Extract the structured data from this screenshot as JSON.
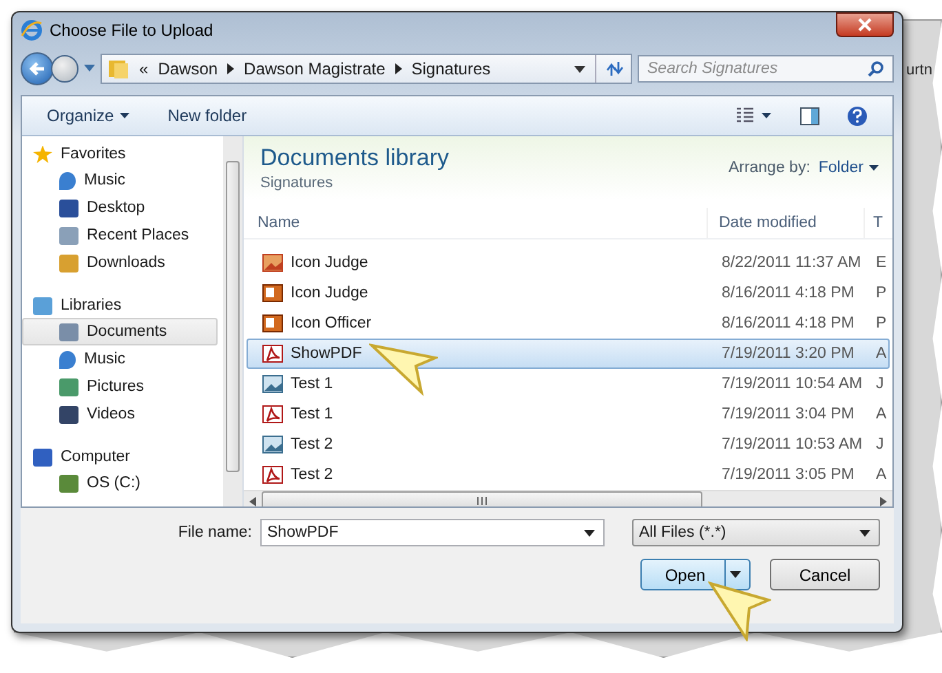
{
  "window": {
    "title": "Choose File to Upload"
  },
  "address_bar": {
    "crumbs": [
      "«",
      "Dawson",
      "Dawson Magistrate",
      "Signatures"
    ]
  },
  "search": {
    "placeholder": "Search Signatures"
  },
  "toolbar": {
    "organize": "Organize",
    "new_folder": "New folder"
  },
  "navigation": [
    {
      "label": "Favorites",
      "kind": "star",
      "children": [
        {
          "label": "Music",
          "kind": "music",
          "selected": false
        },
        {
          "label": "Desktop",
          "kind": "desktop",
          "selected": false
        },
        {
          "label": "Recent Places",
          "kind": "recent",
          "selected": false
        },
        {
          "label": "Downloads",
          "kind": "download",
          "selected": false
        }
      ]
    },
    {
      "label": "Libraries",
      "kind": "library",
      "children": [
        {
          "label": "Documents",
          "kind": "document",
          "selected": true
        },
        {
          "label": "Music",
          "kind": "music",
          "selected": false
        },
        {
          "label": "Pictures",
          "kind": "pictures",
          "selected": false
        },
        {
          "label": "Videos",
          "kind": "videos",
          "selected": false
        }
      ]
    },
    {
      "label": "Computer",
      "kind": "computer",
      "children": [
        {
          "label": "OS (C:)",
          "kind": "drive",
          "selected": false
        }
      ]
    }
  ],
  "library": {
    "title": "Documents library",
    "subtitle": "Signatures",
    "arrange_label": "Arrange by:",
    "arrange_value": "Folder"
  },
  "table": {
    "columns": [
      "Name",
      "Date modified",
      "T"
    ],
    "rows": [
      {
        "name": "Icon Judge",
        "kind": "image",
        "date": "8/22/2011 11:37 AM",
        "column_3": "E",
        "selected": false
      },
      {
        "name": "Icon Judge",
        "kind": "presentation",
        "date": "8/16/2011 4:18 PM",
        "column_3": "P",
        "selected": false
      },
      {
        "name": "Icon Officer",
        "kind": "presentation",
        "date": "8/16/2011 4:18 PM",
        "column_3": "P",
        "selected": false
      },
      {
        "name": "ShowPDF",
        "kind": "pdf",
        "date": "7/19/2011 3:20 PM",
        "column_3": "A",
        "selected": true
      },
      {
        "name": "Test 1",
        "kind": "bitmap",
        "date": "7/19/2011 10:54 AM",
        "column_3": "J",
        "selected": false
      },
      {
        "name": "Test 1",
        "kind": "pdf",
        "date": "7/19/2011 3:04 PM",
        "column_3": "A",
        "selected": false
      },
      {
        "name": "Test 2",
        "kind": "bitmap",
        "date": "7/19/2011 10:53 AM",
        "column_3": "J",
        "selected": false
      },
      {
        "name": "Test 2",
        "kind": "pdf",
        "date": "7/19/2011 3:05 PM",
        "column_3": "A",
        "selected": false
      }
    ]
  },
  "file_name": {
    "label": "File name:",
    "value": "ShowPDF"
  },
  "file_type": {
    "value": "All Files (*.*)"
  },
  "buttons": [
    {
      "label": "Open",
      "kind": "split"
    },
    {
      "label": "Cancel",
      "kind": "plain"
    }
  ],
  "background_page": {
    "fragment": "urtn"
  }
}
